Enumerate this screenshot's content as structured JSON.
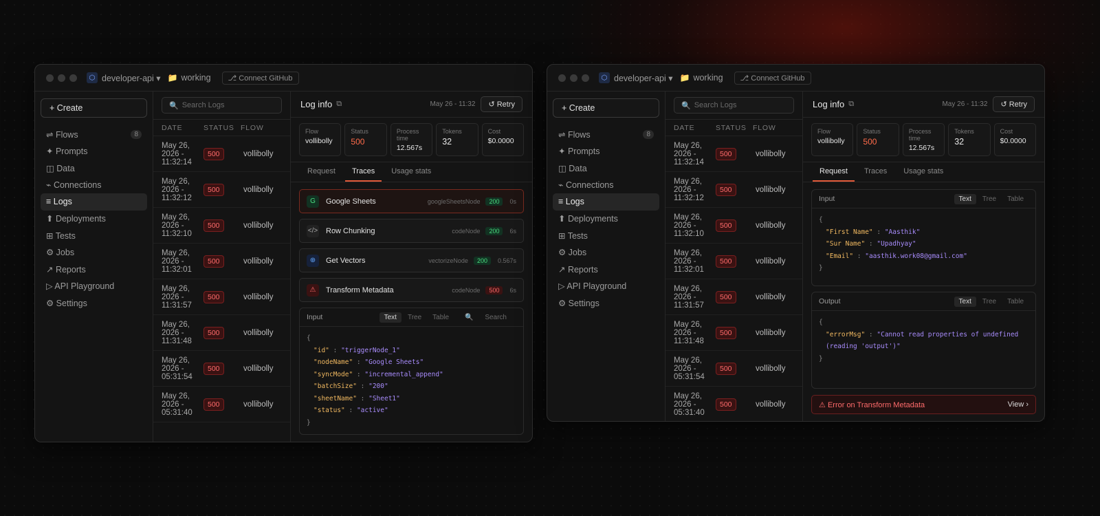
{
  "titlebar": {
    "project": "developer-api ▾",
    "branch": "working",
    "connect": "Connect GitHub"
  },
  "sidebar": {
    "create": "+ Create",
    "items": [
      {
        "label": "⇌ Flows",
        "badge": "8"
      },
      {
        "label": "✦ Prompts"
      },
      {
        "label": "◫ Data"
      },
      {
        "label": "⌁ Connections"
      },
      {
        "label": "≡ Logs"
      },
      {
        "label": "⬆ Deployments"
      },
      {
        "label": "⊞ Tests"
      },
      {
        "label": "⚙ Jobs"
      },
      {
        "label": "↗ Reports"
      },
      {
        "label": "▷ API Playground"
      },
      {
        "label": "⚙ Settings"
      }
    ]
  },
  "list": {
    "search_placeholder": "Search Logs",
    "headers": [
      "DATE",
      "STATUS",
      "FLOW"
    ],
    "rows": [
      {
        "date": "May 26, 2026 - 11:32:14",
        "status": "500",
        "flow": "vollibolly"
      },
      {
        "date": "May 26, 2026 - 11:32:12",
        "status": "500",
        "flow": "vollibolly"
      },
      {
        "date": "May 26, 2026 - 11:32:10",
        "status": "500",
        "flow": "vollibolly"
      },
      {
        "date": "May 26, 2026 - 11:32:01",
        "status": "500",
        "flow": "vollibolly"
      },
      {
        "date": "May 26, 2026 - 11:31:57",
        "status": "500",
        "flow": "vollibolly"
      },
      {
        "date": "May 26, 2026 - 11:31:48",
        "status": "500",
        "flow": "vollibolly"
      },
      {
        "date": "May 26, 2026 - 05:31:54",
        "status": "500",
        "flow": "vollibolly"
      },
      {
        "date": "May 26, 2026 - 05:31:40",
        "status": "500",
        "flow": "vollibolly"
      }
    ]
  },
  "detail": {
    "title": "Log info",
    "date": "May 26 - 11:32",
    "retry": "↺ Retry",
    "stats": {
      "flow_label": "Flow",
      "flow": "vollibolly",
      "status_label": "Status",
      "status": "500",
      "time_label": "Process time",
      "time": "12.567s",
      "tokens_label": "Tokens",
      "tokens": "32",
      "cost_label": "Cost",
      "cost": "$0.0000"
    },
    "tabs": [
      "Request",
      "Traces",
      "Usage stats"
    ]
  },
  "traces": [
    {
      "icon": "G",
      "name": "Google Sheets",
      "node": "googleSheetsNode",
      "status": "200",
      "dur": "0s"
    },
    {
      "icon": "</>",
      "name": "Row Chunking",
      "node": "codeNode",
      "status": "200",
      "dur": "6s"
    },
    {
      "icon": "⊕",
      "name": "Get Vectors",
      "node": "vectorizeNode",
      "status": "200",
      "dur": "0.567s"
    },
    {
      "icon": "⚠",
      "name": "Transform Metadata",
      "node": "codeNode",
      "status": "500",
      "dur": "6s"
    }
  ],
  "panel_labels": {
    "input": "Input",
    "output": "Output",
    "text": "Text",
    "tree": "Tree",
    "table": "Table",
    "search": "Search"
  },
  "trace_input": [
    {
      "k": "\"id\"",
      "v": "\"triggerNode_1\""
    },
    {
      "k": "\"nodeName\"",
      "v": "\"Google Sheets\""
    },
    {
      "k": "\"syncMode\"",
      "v": "\"incremental_append\""
    },
    {
      "k": "\"batchSize\"",
      "v": "\"200\""
    },
    {
      "k": "\"sheetName\"",
      "v": "\"Sheet1\""
    },
    {
      "k": "\"status\"",
      "v": "\"active\""
    }
  ],
  "request_input": [
    {
      "k": "\"First Name\"",
      "v": "\"Aasthik\""
    },
    {
      "k": "\"Sur Name\"",
      "v": "\"Upadhyay\""
    },
    {
      "k": "\"Email\"",
      "v": "\"aasthik.work08@gmail.com\""
    }
  ],
  "request_output": {
    "k": "\"errorMsg\"",
    "v1": "\"Cannot read properties of undefined",
    "v2": "(reading 'output')\""
  },
  "error_bar": {
    "text": "Error on Transform Metadata",
    "view": "View ›"
  },
  "colors": {
    "accent": "#e25a3a",
    "error": "#ff6b6b",
    "ok": "#4ade80"
  }
}
